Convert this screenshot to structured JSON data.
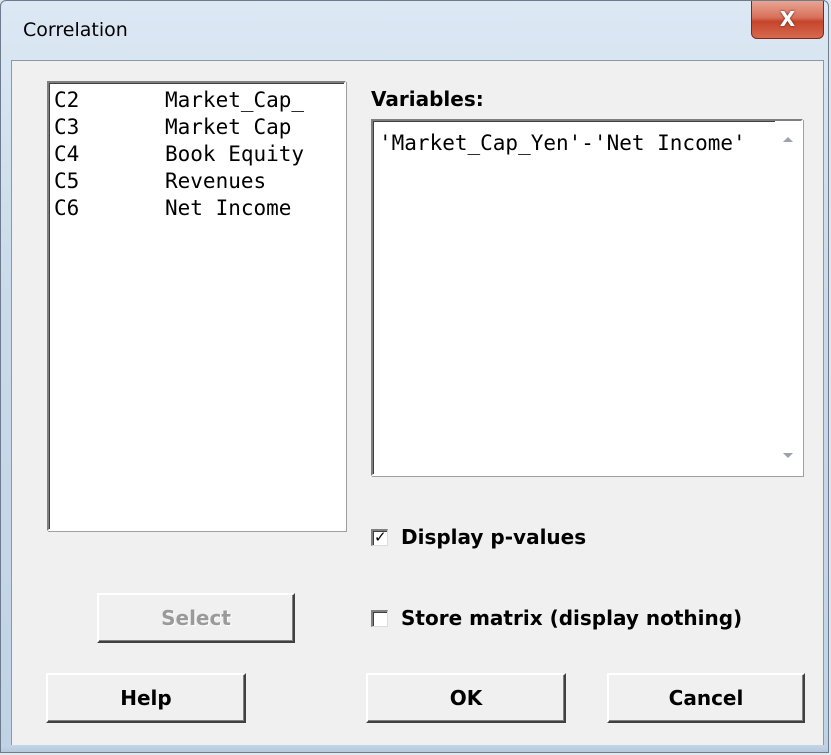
{
  "window": {
    "title": "Correlation",
    "close_label": "X"
  },
  "columns_list": {
    "items": [
      {
        "id": "C2",
        "name": "Market_Cap_"
      },
      {
        "id": "C3",
        "name": "Market Cap"
      },
      {
        "id": "C4",
        "name": "Book Equity"
      },
      {
        "id": "C5",
        "name": "Revenues"
      },
      {
        "id": "C6",
        "name": "Net Income"
      }
    ]
  },
  "variables": {
    "label": "Variables:",
    "value": "'Market_Cap_Yen'-'Net Income'"
  },
  "options": {
    "display_pvalues": {
      "label": "Display p-values",
      "checked": true,
      "mark": "✓"
    },
    "store_matrix": {
      "label": "Store matrix (display nothing)",
      "checked": false
    }
  },
  "buttons": {
    "select": "Select",
    "help": "Help",
    "ok": "OK",
    "cancel": "Cancel"
  }
}
